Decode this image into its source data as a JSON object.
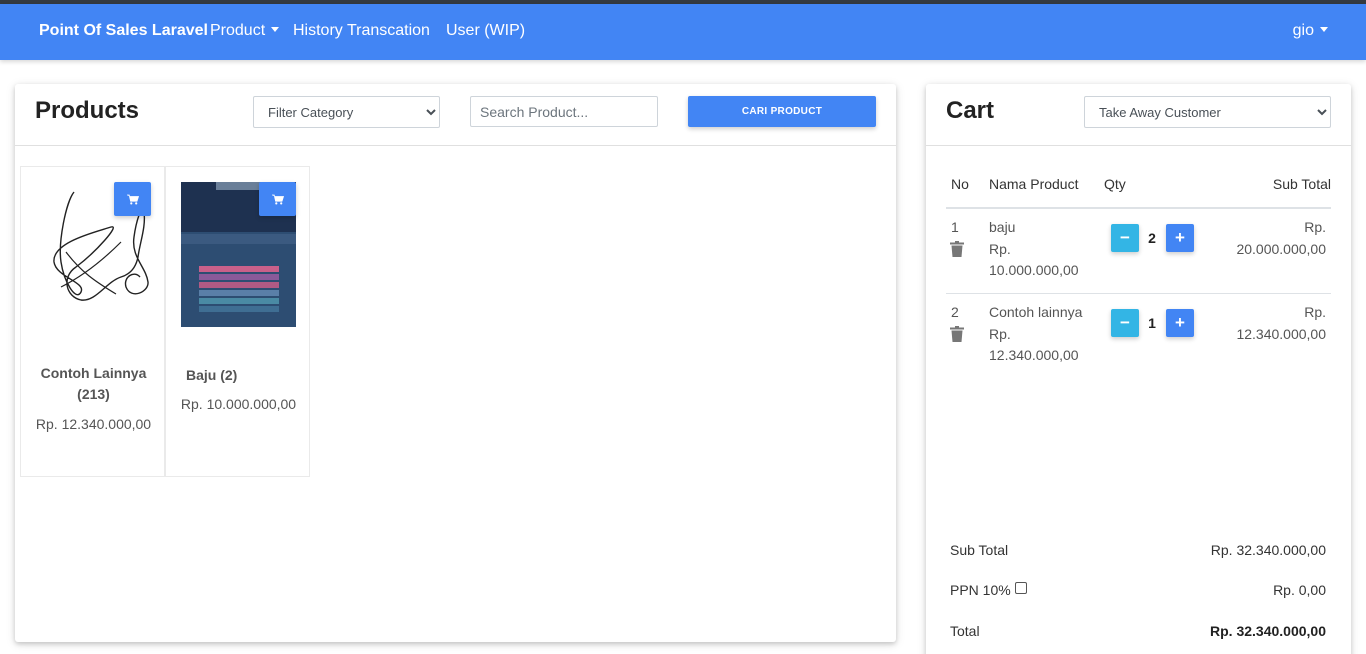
{
  "navbar": {
    "brand": "Point Of Sales Laravel",
    "product": "Product",
    "history": "History Transcation",
    "user": "User (WIP)",
    "account": "gio",
    "color": "#4285f4"
  },
  "products": {
    "title": "Products",
    "filter_selected": "Filter Category",
    "search_placeholder": "Search Product...",
    "search_button": "CARI PRODUCT",
    "items": [
      {
        "name": "Contoh Lainnya (213)",
        "price": "Rp. 12.340.000,00",
        "image": "signature-scribble"
      },
      {
        "name": "Baju (2)",
        "price": "Rp. 10.000.000,00",
        "image": "game-screenshot"
      }
    ]
  },
  "cart": {
    "title": "Cart",
    "customer_selected": "Take Away Customer",
    "columns": [
      "No",
      "Nama Product",
      "Qty",
      "Sub Total"
    ],
    "rows": [
      {
        "no": "1",
        "name": "baju",
        "price": "Rp. 10.000.000,00",
        "qty": "2",
        "subtotal": "Rp. 20.000.000,00"
      },
      {
        "no": "2",
        "name": "Contoh lainnya",
        "price": "Rp. 12.340.000,00",
        "qty": "1",
        "subtotal": "Rp. 12.340.000,00"
      }
    ],
    "summary": {
      "subtotal_label": "Sub Total",
      "subtotal_value": "Rp. 32.340.000,00",
      "ppn_label": "PPN 10%",
      "ppn_checked": false,
      "ppn_value": "Rp. 0,00",
      "total_label": "Total",
      "total_value": "Rp. 32.340.000,00"
    }
  },
  "colors": {
    "primary": "#4285f4",
    "info": "#33b5e5"
  }
}
